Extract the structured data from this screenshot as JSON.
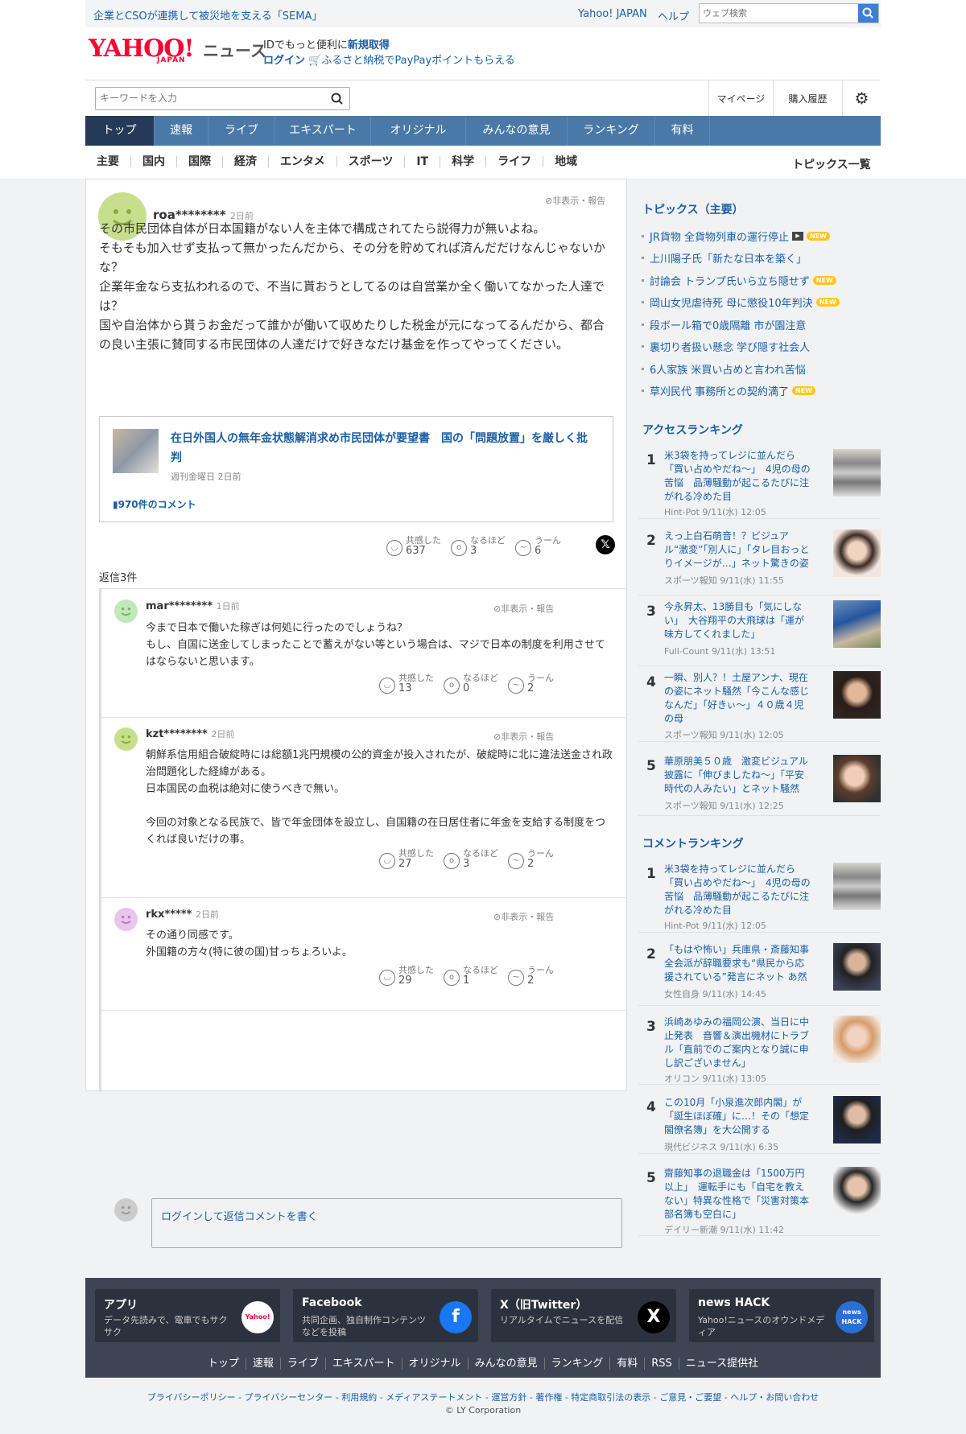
{
  "topbar": {
    "promo": "企業とCSOが連携して被災地を支える「SEMA」",
    "yahoo_japan": "Yahoo! JAPAN",
    "help": "ヘルプ",
    "web_search_placeholder": "ウェブ検索"
  },
  "brand": {
    "logo": "YAHOO!",
    "logo_sub": "JAPAN",
    "news": "ニュース"
  },
  "id_promo": {
    "line1_a": "IDでもっと便利に",
    "line1_b": "新規取得",
    "line2_login": "ログイン",
    "line2_text": "ふるさと納税でPayPayポイントもらえる"
  },
  "section_bar": {
    "search_placeholder": "キーワードを入力",
    "mypage": "マイページ",
    "purchase": "購入履歴"
  },
  "global_nav": [
    "トップ",
    "速報",
    "ライブ",
    "エキスパート",
    "オリジナル",
    "みんなの意見",
    "ランキング",
    "有料"
  ],
  "sub_nav": [
    "主要",
    "国内",
    "国際",
    "経済",
    "エンタメ",
    "スポーツ",
    "IT",
    "科学",
    "ライフ",
    "地域"
  ],
  "topic_list_link": "トピックス一覧",
  "comment": {
    "user": "roa********",
    "time": "2日前",
    "report": "非表示・報告",
    "text": "その市民団体自体が日本国籍がない人を主体で構成されてたら説得力が無いよね。\nそもそも加入せず支払って無かったんだから、その分を貯めてれば済んだだけなんじゃないかな？\n企業年金なら支払われるので、不当に貰おうとしてるのは自営業か全く働いてなかった人達では？\n国や自治体から貰うお金だって誰かが働いて収めたりした税金が元になってるんだから、都合の良い主張に賛同する市民団体の人達だけで好きなだけ基金を作ってやってください。",
    "reactions": {
      "empathy_label": "共感した",
      "empathy": "637",
      "naruhodo_label": "なるほど",
      "naruhodo": "3",
      "uun_label": "うーん",
      "uun": "6"
    }
  },
  "article": {
    "title": "在日外国人の無年金状態解消求め市民団体が要望書　国の「問題放置」を厳しく批判",
    "source": "週刊金曜日 2日前",
    "comments": "970件のコメント"
  },
  "reply_count": "返信3件",
  "replies": [
    {
      "user": "mar********",
      "time": "1日前",
      "report": "非表示・報告",
      "text": "今まで日本で働いた稼ぎは何処に行ったのでしょうね？\nもし、自国に送金してしまったことで蓄えがない等という場合は、マジで日本の制度を利用させてはならないと思います。",
      "empathy": "13",
      "naruhodo": "0",
      "uun": "2"
    },
    {
      "user": "kzt********",
      "time": "2日前",
      "report": "非表示・報告",
      "text": "朝鮮系信用組合破綻時には総額1兆円規模の公的資金が投入されたが、破綻時に北に違法送金され政治問題化した経緯がある。\n日本国民の血税は絶対に使うべきで無い。\n\n今回の対象となる民族で、皆で年金団体を設立し、自国籍の在日居住者に年金を支給する制度をつくれば良いだけの事。",
      "empathy": "27",
      "naruhodo": "3",
      "uun": "2"
    },
    {
      "user": "rkx*****",
      "time": "2日前",
      "report": "非表示・報告",
      "text": "その通り同感です。\n外国籍の方々(特に彼の国)甘っちょろいよ。",
      "empathy": "29",
      "naruhodo": "1",
      "uun": "2"
    }
  ],
  "reply_box": {
    "login": "ログイン",
    "text": "して返信コメントを書く"
  },
  "topics": {
    "heading": "トピックス（主要）",
    "items": [
      {
        "title": "JR貨物 全貨物列車の運行停止",
        "video": true,
        "new": true
      },
      {
        "title": "上川陽子氏「新たな日本を築く」",
        "video": false,
        "new": false
      },
      {
        "title": "討論会 トランプ氏いら立ち隠せず",
        "video": false,
        "new": true
      },
      {
        "title": "岡山女児虐待死 母に懲役10年判決",
        "video": false,
        "new": true
      },
      {
        "title": "段ボール箱で0歳隔離 市が園注意",
        "video": false,
        "new": false
      },
      {
        "title": "裏切り者扱い懸念 学び隠す社会人",
        "video": false,
        "new": false
      },
      {
        "title": "6人家族 米買い占めと言われ苦悩",
        "video": false,
        "new": false
      },
      {
        "title": "草刈民代 事務所との契約満了",
        "video": false,
        "new": true
      }
    ],
    "new_label": "NEW"
  },
  "access_ranking": {
    "heading": "アクセスランキング",
    "items": [
      {
        "rank": "1",
        "title": "米3袋を持ってレジに並んだら「買い占めやだね～」　4児の母の苦悩　品薄騒動が起こるたびに注がれる冷めた目",
        "meta": "Hint-Pot 9/11(水) 12:05"
      },
      {
        "rank": "2",
        "title": "えっ上白石萌音！？ビジュアル“激変”「別人に」「タレ目おっとりイメージが…」ネット驚きの姿",
        "meta": "スポーツ報知 9/11(水) 11:55"
      },
      {
        "rank": "3",
        "title": "今永昇太、13勝目も「気にしない」　大谷翔平の大飛球は「運が味方してくれました」",
        "meta": "Full-Count 9/11(水) 13:51"
      },
      {
        "rank": "4",
        "title": "一瞬、別人？！土屋アンナ、現在の姿にネット騒然「今こんな感じなんだ」「好きぃ～」４０歳４児の母",
        "meta": "スポーツ報知 9/11(水) 12:05"
      },
      {
        "rank": "5",
        "title": "華原朋美５０歳　激変ビジュアル披露に「伸びましたね～」「平安時代の人みたい」とネット騒然",
        "meta": "スポーツ報知 9/11(水) 12:25"
      }
    ]
  },
  "comment_ranking": {
    "heading": "コメントランキング",
    "items": [
      {
        "rank": "1",
        "title": "米3袋を持ってレジに並んだら「買い占めやだね～」　4児の母の苦悩　品薄騒動が起こるたびに注がれる冷めた目",
        "meta": "Hint-Pot 9/11(水) 12:05"
      },
      {
        "rank": "2",
        "title": "「もはや怖い」兵庫県・斎藤知事 全会派が辞職要求も“県民から応援されている”発言にネット あ然",
        "meta": "女性自身 9/11(水) 14:45"
      },
      {
        "rank": "3",
        "title": "浜崎あゆみの福岡公演、当日に中止発表　音響＆演出機材にトラブル「直前でのご案内となり誠に申し訳ございません」",
        "meta": "オリコン 9/11(水) 13:05"
      },
      {
        "rank": "4",
        "title": "この10月「小泉進次郎内閣」が「誕生ほぼ確」に…！その「想定閣僚名簿」を大公開する",
        "meta": "現代ビジネス 9/11(水) 6:35"
      },
      {
        "rank": "5",
        "title": "齋藤知事の退職金は「1500万円以上」　運転手にも「自宅を教えない」特異な性格で「災害対策本部名簿も空白に」",
        "meta": "デイリー新潮 9/11(水) 11:42"
      }
    ]
  },
  "footer": {
    "boxes": [
      {
        "title": "アプリ",
        "desc": "データ先読みで、電車でもサクサク",
        "icon": "Yahoo!"
      },
      {
        "title": "Facebook",
        "desc": "共同企画、独自制作コンテンツなどを投稿",
        "icon": "f"
      },
      {
        "title": "X（旧Twitter）",
        "desc": "リアルタイムでニュースを配信",
        "icon": "X"
      },
      {
        "title": "news HACK",
        "desc": "Yahoo!ニュースのオウンドメディア",
        "icon": "news HACK"
      }
    ],
    "links": [
      "トップ",
      "速報",
      "ライブ",
      "エキスパート",
      "オリジナル",
      "みんなの意見",
      "ランキング",
      "有料",
      "RSS",
      "ニュース提供社"
    ],
    "legal": "プライバシーポリシー - プライバシーセンター - 利用規約 - メディアステートメント - 運営方針 - 著作権 - 特定商取引法の表示 - ご意見・ご要望 - ヘルプ・お問い合わせ",
    "copyright": "© LY Corporation"
  },
  "colors": {
    "link": "#1a5fa6",
    "nav": "#4a79a7",
    "nav_active": "#253a59",
    "logo": "#ff0033",
    "new_badge": "#ffc61a",
    "footer": "#3d4453"
  }
}
